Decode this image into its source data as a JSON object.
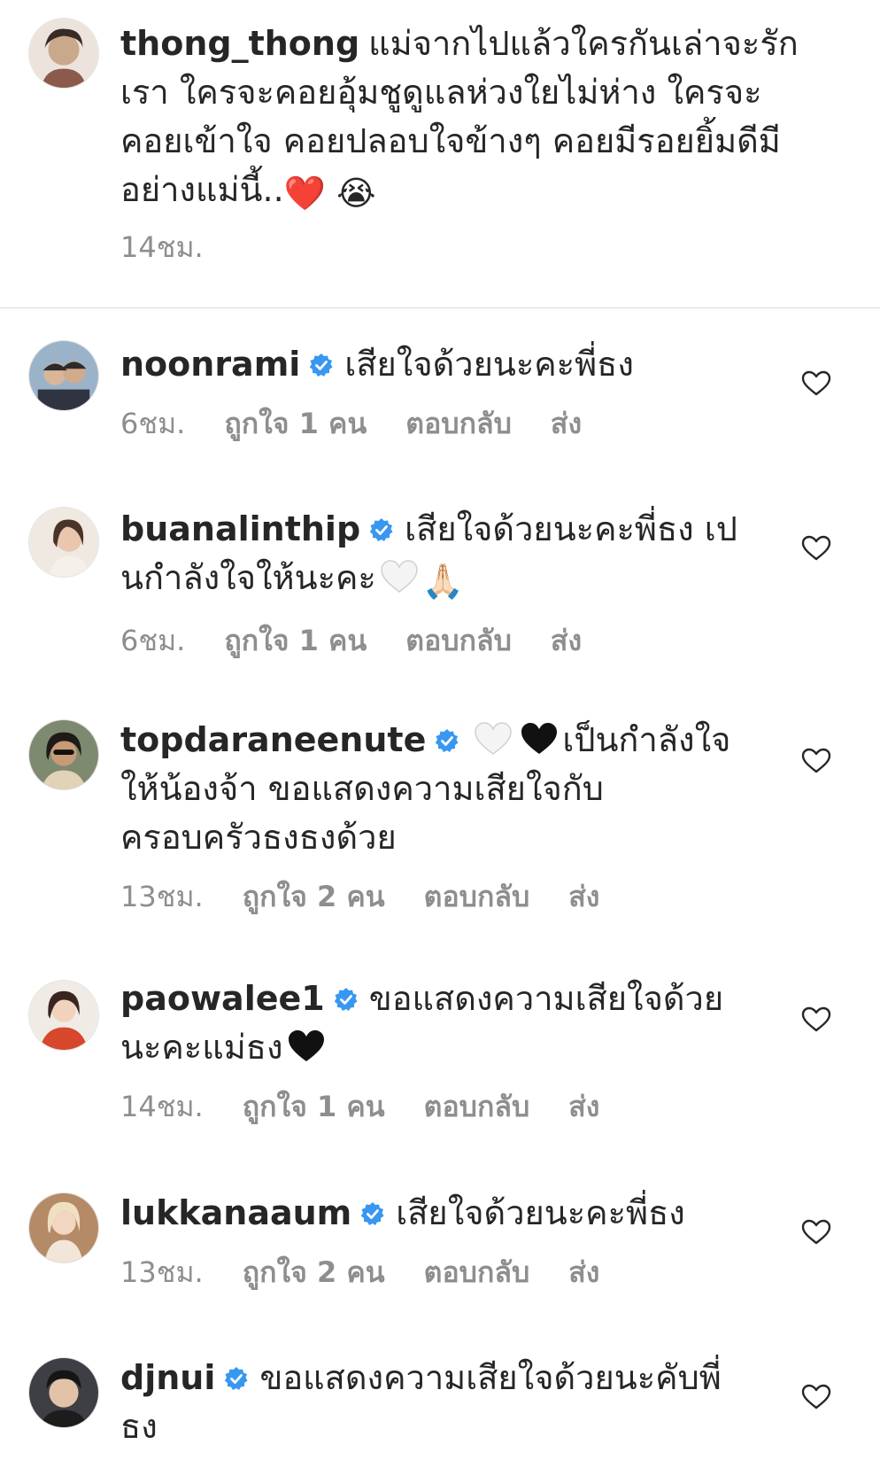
{
  "caption": {
    "username": "thong_thong",
    "text": "แม่จากไปแล้วใครกันเล่าจะรักเรา ใครจะคอยอุ้มชูดูแลห่วงใยไม่ห่าง ใครจะคอยเข้าใจ คอยปลอบใจข้างๆ คอยมีรอยยิ้มดีมีอย่างแม่นี้..",
    "emoji_1": "❤️",
    "emoji_2": "😭",
    "time": "14ชม."
  },
  "comments": [
    {
      "username": "noonrami",
      "text": "เสียใจด้วยนะคะพี่ธง",
      "time": "6ชม.",
      "likes": "ถูกใจ 1 คน",
      "reply": "ตอบกลับ",
      "send": "ส่ง"
    },
    {
      "username": "buanalinthip",
      "text": "เสียใจด้วยนะคะพี่ธง เปนกำลังใจให้นะคะ",
      "emoji_1": "🙏🏻",
      "time": "6ชม.",
      "likes": "ถูกใจ 1 คน",
      "reply": "ตอบกลับ",
      "send": "ส่ง"
    },
    {
      "username": "topdaraneenute",
      "text": "เป็นกำลังใจให้น้องจ้า ขอแสดงความเสียใจกับครอบครัวธงธงด้วย",
      "time": "13ชม.",
      "likes": "ถูกใจ 2 คน",
      "reply": "ตอบกลับ",
      "send": "ส่ง"
    },
    {
      "username": "paowalee1",
      "text": "ขอแสดงความเสียใจด้วยนะคะแม่ธง",
      "time": "14ชม.",
      "likes": "ถูกใจ 1 คน",
      "reply": "ตอบกลับ",
      "send": "ส่ง"
    },
    {
      "username": "lukkanaaum",
      "text": "เสียใจด้วยนะคะพี่ธง",
      "time": "13ชม.",
      "likes": "ถูกใจ 2 คน",
      "reply": "ตอบกลับ",
      "send": "ส่ง"
    },
    {
      "username": "djnui",
      "text": "ขอแสดงความเสียใจด้วยนะคับพี่ธง"
    }
  ],
  "colors": {
    "text": "#262626",
    "meta": "#8e8e8e",
    "verified": "#3897f0",
    "divider": "#dbdbdb"
  },
  "icons": {
    "verified": "verified-badge-icon",
    "like": "heart-outline-icon"
  }
}
